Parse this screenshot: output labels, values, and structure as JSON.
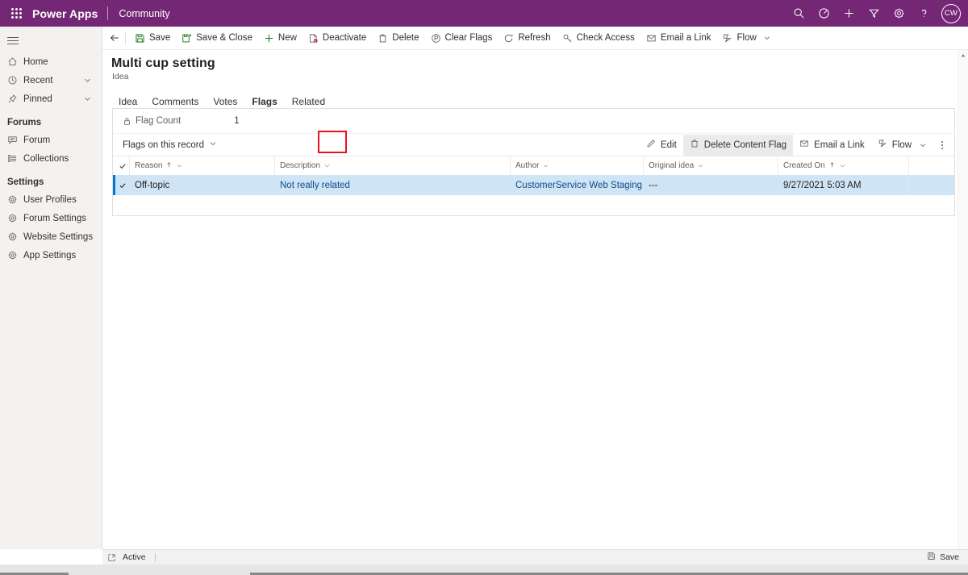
{
  "topbar": {
    "waffle_name": "app-launcher-icon",
    "brand": "Power Apps",
    "app_name": "Community",
    "icons": [
      {
        "name": "search-icon",
        "label": "Search"
      },
      {
        "name": "target-icon",
        "label": "Environment"
      },
      {
        "name": "plus-icon",
        "label": "New"
      },
      {
        "name": "filter-icon",
        "label": "Filter"
      },
      {
        "name": "gear-icon",
        "label": "Settings"
      },
      {
        "name": "help-icon",
        "label": "Help"
      }
    ],
    "avatar_initials": "CW",
    "background_color": "#742774"
  },
  "sidebar": {
    "items": [
      {
        "label": "Home",
        "icon": "home-icon",
        "chevron": false
      },
      {
        "label": "Recent",
        "icon": "clock-icon",
        "chevron": true
      },
      {
        "label": "Pinned",
        "icon": "pin-icon",
        "chevron": true
      }
    ],
    "groups": [
      {
        "title": "Forums",
        "items": [
          {
            "label": "Forum",
            "icon": "forum-icon"
          },
          {
            "label": "Collections",
            "icon": "collections-icon"
          }
        ]
      },
      {
        "title": "Settings",
        "items": [
          {
            "label": "User Profiles",
            "icon": "gear-icon"
          },
          {
            "label": "Forum Settings",
            "icon": "gear-icon"
          },
          {
            "label": "Website Settings",
            "icon": "gear-icon"
          },
          {
            "label": "App Settings",
            "icon": "gear-icon"
          }
        ]
      }
    ]
  },
  "commandbar": {
    "back_label": "Back",
    "commands": [
      {
        "label": "Save",
        "icon": "save-icon",
        "chevron": false
      },
      {
        "label": "Save & Close",
        "icon": "save-close-icon",
        "chevron": false
      },
      {
        "label": "New",
        "icon": "plus-icon",
        "chevron": false
      },
      {
        "label": "Deactivate",
        "icon": "deactivate-icon",
        "chevron": false
      },
      {
        "label": "Delete",
        "icon": "trash-icon",
        "chevron": false
      },
      {
        "label": "Clear Flags",
        "icon": "clear-flags-icon",
        "chevron": false
      },
      {
        "label": "Refresh",
        "icon": "refresh-icon",
        "chevron": false
      },
      {
        "label": "Check Access",
        "icon": "key-icon",
        "chevron": false
      },
      {
        "label": "Email a Link",
        "icon": "email-link-icon",
        "chevron": false
      },
      {
        "label": "Flow",
        "icon": "flow-icon",
        "chevron": true
      }
    ]
  },
  "record": {
    "title": "Multi cup setting",
    "entity": "Idea"
  },
  "tabs": [
    {
      "label": "Idea",
      "selected": false,
      "highlighted": false
    },
    {
      "label": "Comments",
      "selected": false,
      "highlighted": false
    },
    {
      "label": "Votes",
      "selected": false,
      "highlighted": false
    },
    {
      "label": "Flags",
      "selected": true,
      "highlighted": true
    },
    {
      "label": "Related",
      "selected": false,
      "highlighted": false
    }
  ],
  "highlight_color": "#e81123",
  "accent_color": "#0078d4",
  "flag_count": {
    "lock_icon": "lock-icon",
    "label": "Flag Count",
    "value": "1"
  },
  "subgrid": {
    "title": "Flags on this record",
    "toolbar": [
      {
        "label": "Edit",
        "icon": "pencil-icon",
        "chevron": false,
        "active": false
      },
      {
        "label": "Delete Content Flag",
        "icon": "trash-icon",
        "chevron": false,
        "active": true
      },
      {
        "label": "Email a Link",
        "icon": "email-link-icon",
        "chevron": false,
        "active": false
      },
      {
        "label": "Flow",
        "icon": "flow-icon",
        "chevron": true,
        "active": false
      }
    ],
    "overflow_label": "More commands",
    "columns": [
      {
        "label": "Reason",
        "sorted": true,
        "sort_dir": "asc"
      },
      {
        "label": "Description",
        "sorted": false,
        "sort_dir": ""
      },
      {
        "label": "Author",
        "sorted": false,
        "sort_dir": ""
      },
      {
        "label": "Original idea",
        "sorted": false,
        "sort_dir": ""
      },
      {
        "label": "Created On",
        "sorted": true,
        "sort_dir": "asc"
      }
    ],
    "rows": [
      {
        "selected": true,
        "reason": "Off-topic",
        "description": "Not really related",
        "author": "CustomerService Web Staging",
        "original_idea": "---",
        "created_on": "9/27/2021 5:03 AM"
      }
    ]
  },
  "statusbar": {
    "state_icon": "open-record-icon",
    "state": "Active",
    "save_label": "Save",
    "save_icon": "save-icon"
  }
}
